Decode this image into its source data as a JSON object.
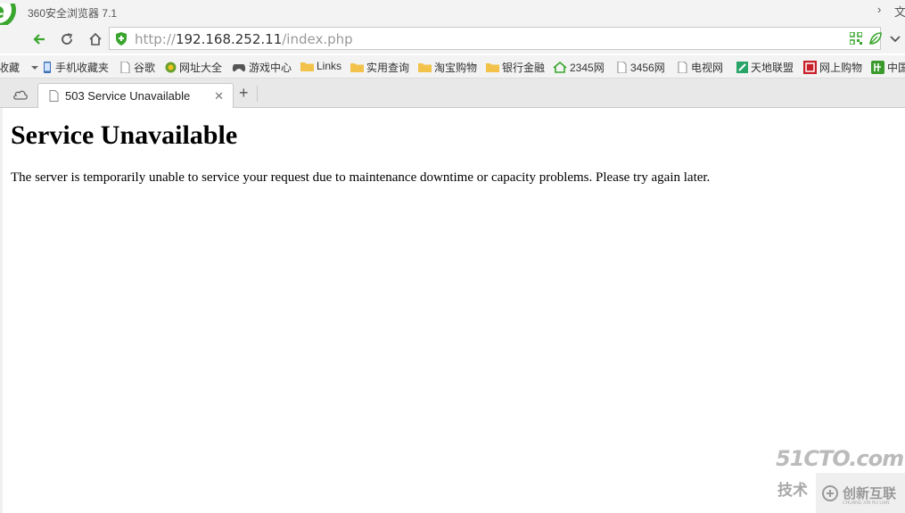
{
  "window": {
    "title": "360安全浏览器 7.1",
    "menu_chevron": "›",
    "menu_text": "文"
  },
  "nav": {
    "url_scheme": "http://",
    "url_host": "192.168.252.11",
    "url_path": "/index.php"
  },
  "bookmarks": {
    "items": [
      {
        "label": "收藏",
        "icon": "star-icon"
      },
      {
        "label": "手机收藏夹",
        "icon": "phone-icon"
      },
      {
        "label": "谷歌",
        "icon": "page-icon"
      },
      {
        "label": "网址大全",
        "icon": "site-icon"
      },
      {
        "label": "游戏中心",
        "icon": "gamepad-icon"
      },
      {
        "label": "Links",
        "icon": "folder-icon"
      },
      {
        "label": "实用查询",
        "icon": "folder-icon"
      },
      {
        "label": "淘宝购物",
        "icon": "folder-icon"
      },
      {
        "label": "银行金融",
        "icon": "folder-icon"
      },
      {
        "label": "2345网",
        "icon": "house-icon"
      },
      {
        "label": "3456网",
        "icon": "page-icon"
      },
      {
        "label": "电视网",
        "icon": "page-icon"
      },
      {
        "label": "天地联盟",
        "icon": "site-icon"
      },
      {
        "label": "网上购物",
        "icon": "site-icon"
      },
      {
        "label": "中国",
        "icon": "site-icon"
      }
    ]
  },
  "tabs": [
    {
      "label": "503 Service Unavailable",
      "active": true
    }
  ],
  "page": {
    "heading": "Service Unavailable",
    "body": "The server is temporarily unable to service your request due to maintenance downtime or capacity problems. Please try again later."
  },
  "watermark": {
    "brand": "51CTO.com",
    "slogan": "技术",
    "partner": "创新互联",
    "partner_sub": "CHUANG XIN HU LIAN"
  },
  "colors": {
    "accent_green": "#3aa62e",
    "chrome_bg": "#f3f3f3"
  }
}
